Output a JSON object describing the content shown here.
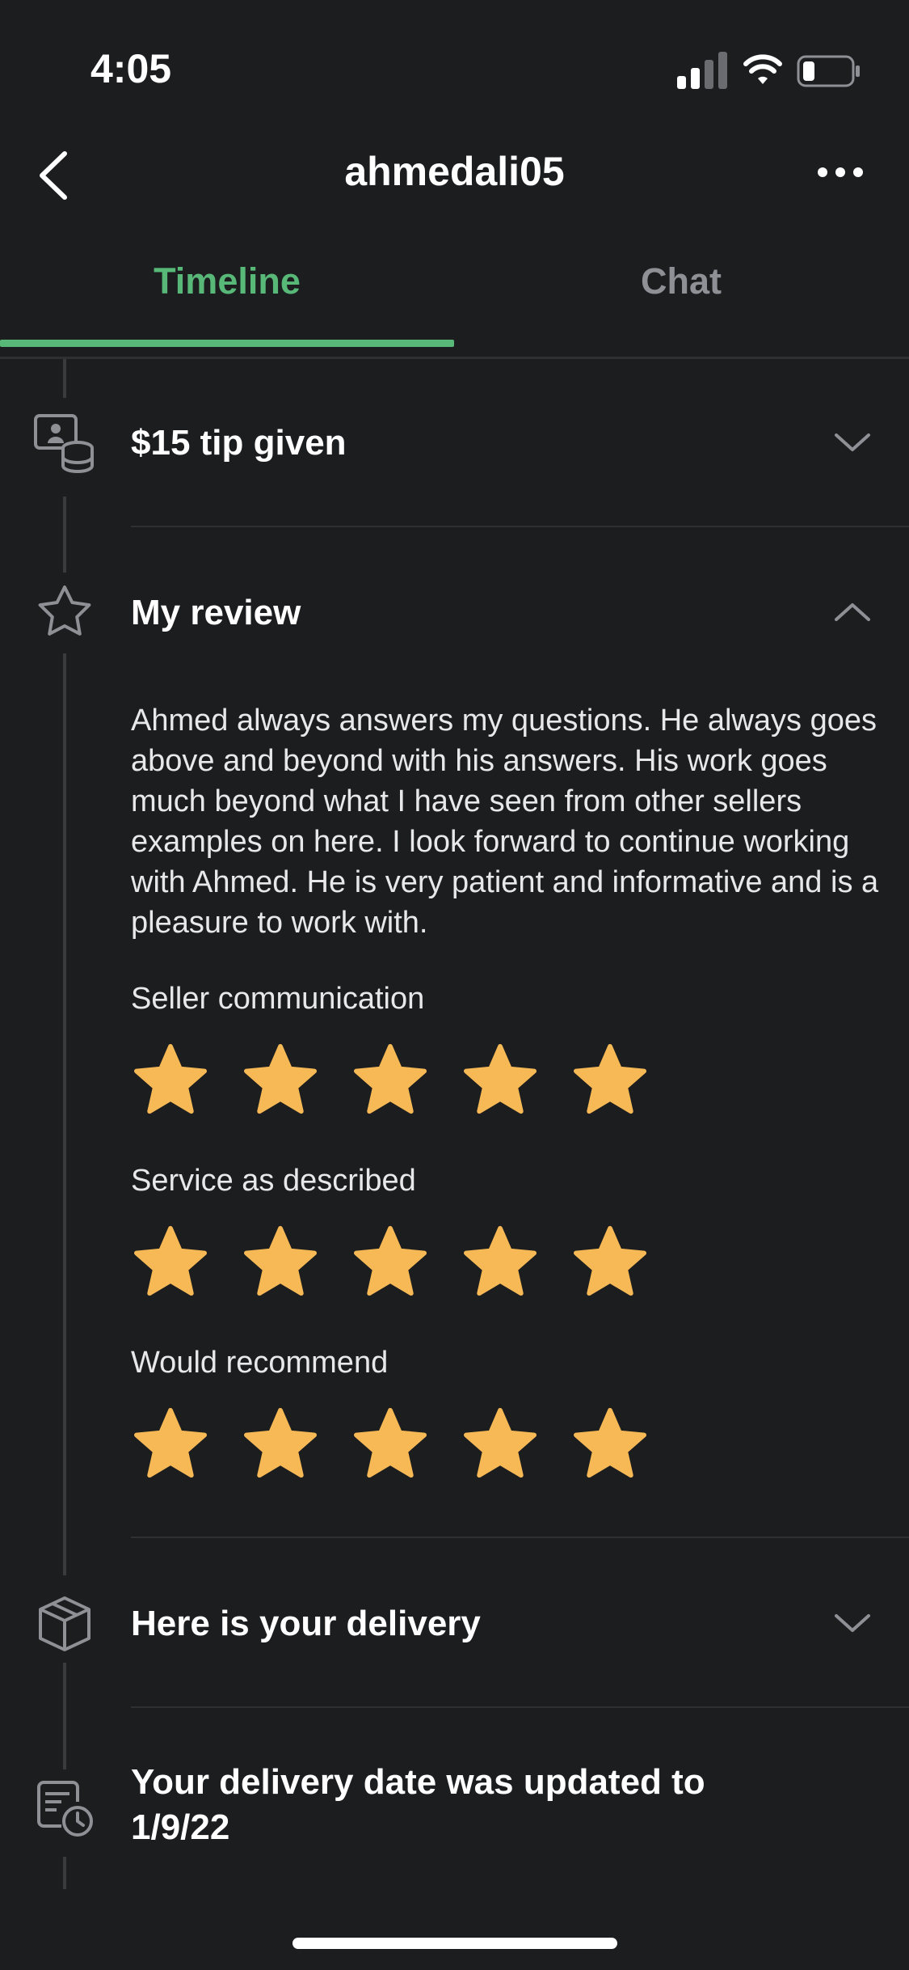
{
  "status_bar": {
    "time": "4:05"
  },
  "header": {
    "title": "ahmedali05"
  },
  "tabs": [
    {
      "label": "Timeline",
      "active": true
    },
    {
      "label": "Chat",
      "active": false
    }
  ],
  "timeline": {
    "tip": {
      "title": "$15 tip given",
      "icon": "payment-icon"
    },
    "review": {
      "title": "My review",
      "icon": "star-outline-icon",
      "text": "Ahmed always answers my questions. He always goes above and beyond with his answers. His work goes much beyond what I have seen from other sellers examples on here. I look forward to continue working with Ahmed. He is very patient and informative and is a pleasure to work with.",
      "ratings": [
        {
          "label": "Seller communication",
          "stars": 5
        },
        {
          "label": "Service as described",
          "stars": 5
        },
        {
          "label": "Would recommend",
          "stars": 5
        }
      ]
    },
    "delivery": {
      "title": "Here is your delivery",
      "icon": "package-icon"
    },
    "date_update": {
      "title": "Your delivery date was updated to 1/9/22",
      "icon": "calendar-clock-icon"
    }
  },
  "colors": {
    "accent": "#58b878",
    "star": "#f7b955",
    "background": "#1c1d1f"
  }
}
